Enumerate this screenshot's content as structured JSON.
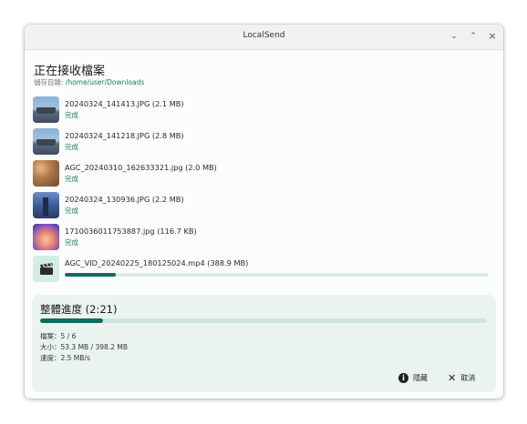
{
  "window": {
    "title": "LocalSend",
    "controls": {
      "minimize": "⌄",
      "maximize": "⌃",
      "close": "×"
    }
  },
  "heading": "正在接收檔案",
  "save_dir": {
    "label": "儲存目錄: ",
    "path": "/home/user/Downloads"
  },
  "files": [
    {
      "name": "20240324_141413.JPG (2.1 MB)",
      "status": "完成",
      "thumb": "ship-photo"
    },
    {
      "name": "20240324_141218.JPG (2.8 MB)",
      "status": "完成",
      "thumb": "ship-photo"
    },
    {
      "name": "AGC_20240310_162633321.jpg (2.0 MB)",
      "status": "完成",
      "thumb": "food-photo"
    },
    {
      "name": "20240324_130936.JPG (2.2 MB)",
      "status": "完成",
      "thumb": "city-photo"
    },
    {
      "name": "1710036011753887.jpg (116.7 KB)",
      "status": "完成",
      "thumb": "cartoon-image"
    },
    {
      "name": "AGC_VID_20240225_180125024.mp4 (388.9 MB)",
      "status": "",
      "thumb": "video-clapper-icon",
      "progress": 0.12
    }
  ],
  "overall": {
    "title": "整體進度 (2:21)",
    "progress": 0.14,
    "files": "檔案：5 / 6",
    "size": "大小：53.3 MB / 398.2 MB",
    "speed": "速度：2.5 MB/s"
  },
  "actions": {
    "hide": "隱藏",
    "cancel": "取消"
  },
  "colors": {
    "accent": "#0f6b5f",
    "status_text": "#1a7a6c",
    "panel_bg": "#eaf3f0"
  }
}
